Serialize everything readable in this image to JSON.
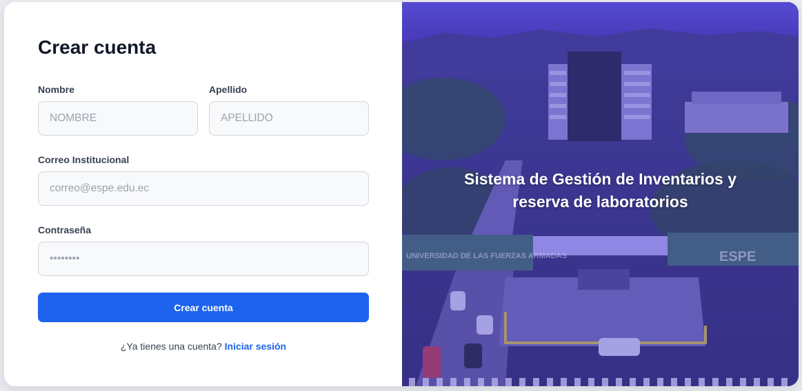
{
  "form": {
    "title": "Crear cuenta",
    "nombre": {
      "label": "Nombre",
      "placeholder": "NOMBRE",
      "value": ""
    },
    "apellido": {
      "label": "Apellido",
      "placeholder": "APELLIDO",
      "value": ""
    },
    "correo": {
      "label": "Correo Institucional",
      "placeholder": "correo@espe.edu.ec",
      "value": ""
    },
    "contrasena": {
      "label": "Contraseña",
      "placeholder": "••••••••",
      "value": ""
    },
    "submit_label": "Crear cuenta",
    "signin_prompt": "¿Ya tienes una cuenta?",
    "signin_link": "Iniciar sesión"
  },
  "hero": {
    "line1": "Sistema de Gestión de Inventarios y",
    "line2": "reserva de laboratorios",
    "sign_left": "UNIVERSIDAD DE LAS FUERZAS ARMADAS",
    "sign_right": "ESPE"
  },
  "colors": {
    "primary": "#1d63ed",
    "overlay": "#4b3fc4",
    "title": "#111827"
  }
}
